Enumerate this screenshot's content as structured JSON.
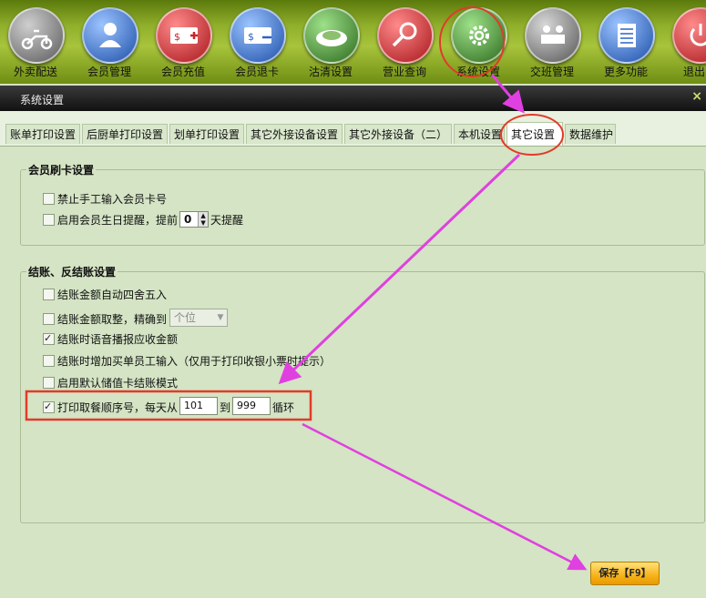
{
  "toolbar": {
    "items": [
      {
        "label": "外卖配送",
        "icon": "scooter-icon",
        "color": "#8a8a8a"
      },
      {
        "label": "会员管理",
        "icon": "member-icon",
        "color": "#2a64c8"
      },
      {
        "label": "会员充值",
        "icon": "card-plus-icon",
        "color": "#c8252a"
      },
      {
        "label": "会员退卡",
        "icon": "card-minus-icon",
        "color": "#2a64c8"
      },
      {
        "label": "沽清设置",
        "icon": "plate-icon",
        "color": "#3c8a2a"
      },
      {
        "label": "营业查询",
        "icon": "magnifier-icon",
        "color": "#c8252a"
      },
      {
        "label": "系统设置",
        "icon": "gear-icon",
        "color": "#3c8a2a"
      },
      {
        "label": "交班管理",
        "icon": "people-icon",
        "color": "#777777"
      },
      {
        "label": "更多功能",
        "icon": "list-icon",
        "color": "#2a64c8"
      },
      {
        "label": "退出系",
        "icon": "power-icon",
        "color": "#c8252a"
      }
    ]
  },
  "window": {
    "title": "系统设置",
    "close": "×"
  },
  "tabs": [
    "账单打印设置",
    "后厨单打印设置",
    "划单打印设置",
    "其它外接设备设置",
    "其它外接设备（二）",
    "本机设置",
    "其它设置",
    "数据维护"
  ],
  "active_tab": "其它设置",
  "member_group": {
    "title": "会员刷卡设置",
    "forbid_manual": {
      "label": "禁止手工输入会员卡号",
      "checked": false
    },
    "birthday": {
      "label_before": "启用会员生日提醒，提前",
      "value": "0",
      "label_after": "天提醒",
      "checked": false
    }
  },
  "checkout_group": {
    "title": "结账、反结账设置",
    "round": {
      "label": "结账金额自动四舍五入",
      "checked": false
    },
    "integer": {
      "label": "结账金额取整，精确到",
      "checked": false,
      "select_value": "个位"
    },
    "voice": {
      "label": "结账时语音播报应收金额",
      "checked": true
    },
    "staff_input": {
      "label": "结账时增加买单员工输入（仅用于打印收银小票时提示）",
      "checked": false
    },
    "stored_card": {
      "label": "启用默认储值卡结账模式",
      "checked": false
    },
    "sequence": {
      "label_before": "打印取餐顺序号，每天从",
      "from": "101",
      "mid": "到",
      "to": "999",
      "label_after": "循环",
      "checked": true
    }
  },
  "save_button": "保存【F9】",
  "annotation_color": "#e040e0",
  "highlight_color": "#e23a2a"
}
